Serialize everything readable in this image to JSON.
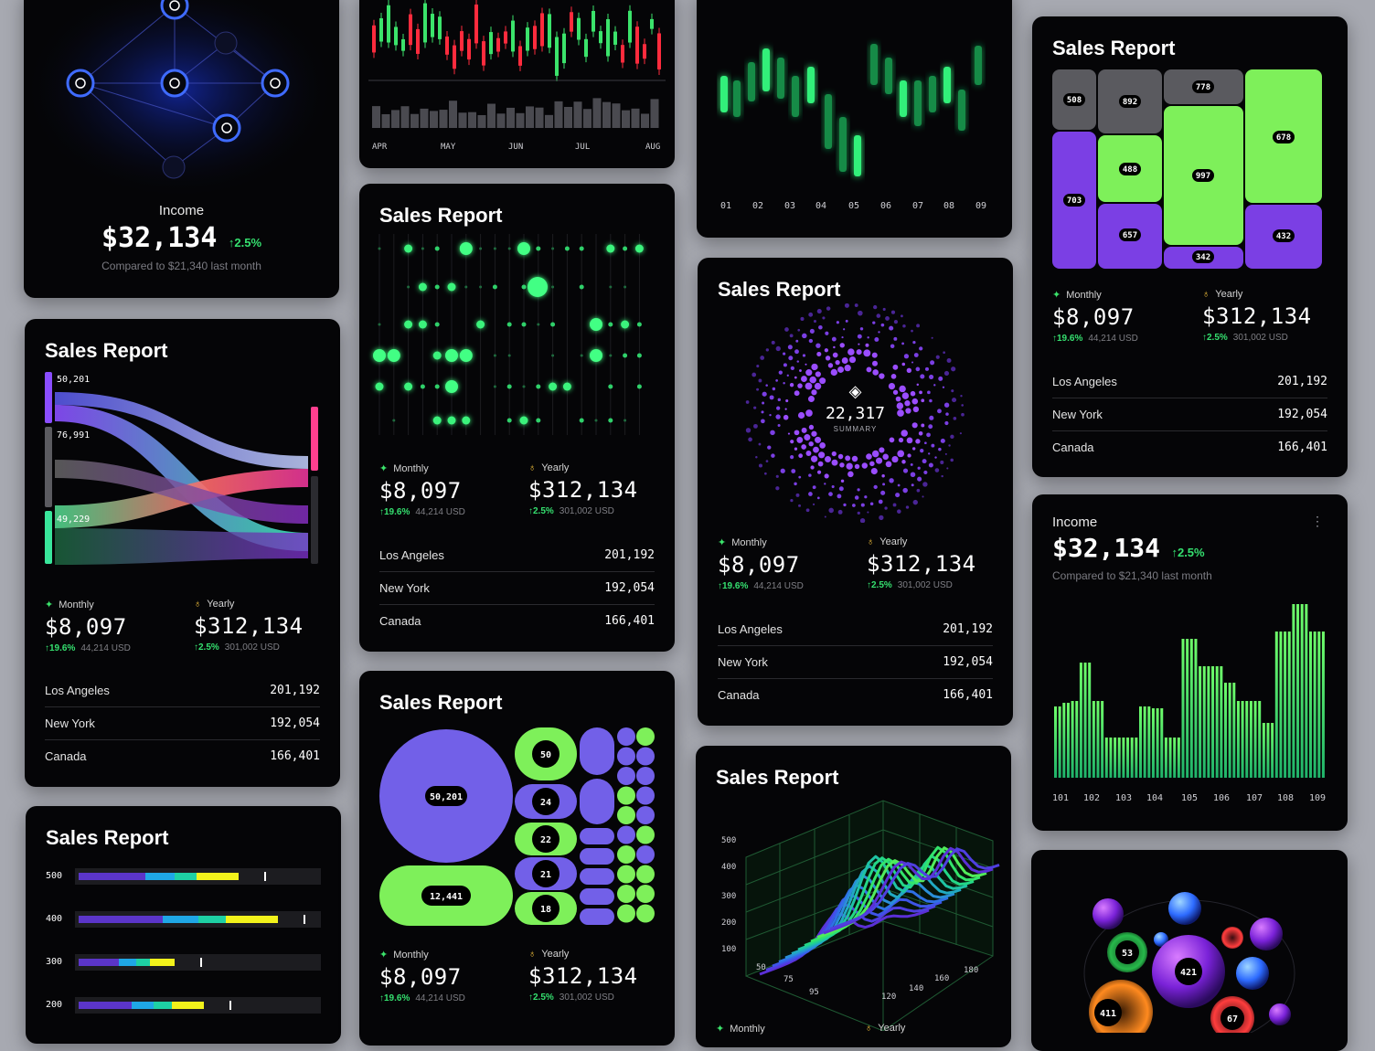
{
  "income_card": {
    "label": "Income",
    "amount": "$32,134",
    "change": "↑2.5%",
    "compare": "Compared to $21,340 last month"
  },
  "income_card_2": {
    "label": "Income",
    "amount": "$32,134",
    "change": "↑2.5%",
    "compare": "Compared to $21,340 last month",
    "x_labels": [
      "101",
      "102",
      "103",
      "104",
      "105",
      "106",
      "107",
      "108",
      "109"
    ]
  },
  "candle_card": {
    "months": [
      "APR",
      "MAY",
      "JUN",
      "JUL",
      "AUG"
    ]
  },
  "bars_card": {
    "x_labels": [
      "01",
      "02",
      "03",
      "04",
      "05",
      "06",
      "07",
      "08",
      "09"
    ]
  },
  "sankey_card": {
    "title": "Sales Report",
    "nodes": [
      "50,201",
      "76,991",
      "49,229"
    ],
    "monthly_label": "Monthly",
    "monthly_value": "$8,097",
    "monthly_pct": "↑19.6%",
    "monthly_usd": "44,214 USD",
    "yearly_label": "Yearly",
    "yearly_value": "$312,134",
    "yearly_pct": "↑2.5%",
    "yearly_usd": "301,002 USD",
    "rows": [
      {
        "city": "Los Angeles",
        "value": "201,192"
      },
      {
        "city": "New York",
        "value": "192,054"
      },
      {
        "city": "Canada",
        "value": "166,401"
      }
    ]
  },
  "dots_card": {
    "title": "Sales Report",
    "monthly_label": "Monthly",
    "monthly_value": "$8,097",
    "monthly_pct": "↑19.6%",
    "monthly_usd": "44,214 USD",
    "yearly_label": "Yearly",
    "yearly_value": "$312,134",
    "yearly_pct": "↑2.5%",
    "yearly_usd": "301,002 USD",
    "rows": [
      {
        "city": "Los Angeles",
        "value": "201,192"
      },
      {
        "city": "New York",
        "value": "192,054"
      },
      {
        "city": "Canada",
        "value": "166,401"
      }
    ]
  },
  "radial_card": {
    "title": "Sales Report",
    "center_value": "22,317",
    "center_label": "SUMMARY",
    "monthly_label": "Monthly",
    "monthly_value": "$8,097",
    "monthly_pct": "↑19.6%",
    "monthly_usd": "44,214 USD",
    "yearly_label": "Yearly",
    "yearly_value": "$312,134",
    "yearly_pct": "↑2.5%",
    "yearly_usd": "301,002 USD",
    "rows": [
      {
        "city": "Los Angeles",
        "value": "201,192"
      },
      {
        "city": "New York",
        "value": "192,054"
      },
      {
        "city": "Canada",
        "value": "166,401"
      }
    ]
  },
  "treemap_card": {
    "title": "Sales Report",
    "cells": [
      "508",
      "892",
      "778",
      "678",
      "703",
      "488",
      "997",
      "657",
      "342",
      "432"
    ],
    "monthly_label": "Monthly",
    "monthly_value": "$8,097",
    "monthly_pct": "↑19.6%",
    "monthly_usd": "44,214 USD",
    "yearly_label": "Yearly",
    "yearly_value": "$312,134",
    "yearly_pct": "↑2.5%",
    "yearly_usd": "301,002 USD",
    "rows": [
      {
        "city": "Los Angeles",
        "value": "201,192"
      },
      {
        "city": "New York",
        "value": "192,054"
      },
      {
        "city": "Canada",
        "value": "166,401"
      }
    ]
  },
  "progress_card": {
    "title": "Sales Report",
    "rows": [
      {
        "label": "500",
        "fill": 0.68
      },
      {
        "label": "400",
        "fill": 0.84
      },
      {
        "label": "300",
        "fill": 0.42
      },
      {
        "label": "200",
        "fill": 0.54
      }
    ]
  },
  "bubble_card": {
    "title": "Sales Report",
    "labels": [
      "50,201",
      "50",
      "24",
      "22",
      "21",
      "12,441",
      "18"
    ],
    "monthly_label": "Monthly",
    "monthly_value": "$8,097",
    "monthly_pct": "↑19.6%",
    "monthly_usd": "44,214 USD",
    "yearly_label": "Yearly",
    "yearly_value": "$312,134",
    "yearly_pct": "↑2.5%",
    "yearly_usd": "301,002 USD"
  },
  "surface_card": {
    "title": "Sales Report",
    "y_ticks": [
      "500",
      "400",
      "300",
      "200",
      "100"
    ],
    "x_ticks": [
      "50",
      "75",
      "95",
      "120",
      "140",
      "160",
      "180"
    ],
    "monthly_label": "Monthly",
    "yearly_label": "Yearly"
  },
  "orbs_card": {
    "labels": [
      "53",
      "421",
      "411",
      "67"
    ]
  },
  "colors": {
    "accent_green": "#3be36b",
    "purple": "#7b3fe4",
    "lime": "#7ef05a",
    "card": "#050507"
  }
}
